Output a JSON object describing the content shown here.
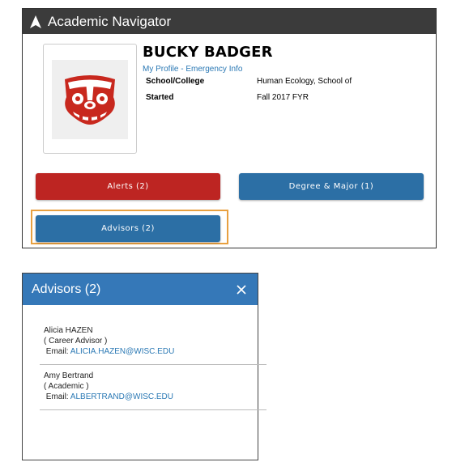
{
  "app": {
    "title": "Academic Navigator"
  },
  "profile": {
    "name": "BUCKY BADGER",
    "my_profile_link": "My Profile",
    "separator": " - ",
    "emergency_link": "Emergency Info",
    "fields": [
      {
        "label": "School/College",
        "value": "Human Ecology, School of"
      },
      {
        "label": "Started",
        "value": "Fall 2017 FYR"
      }
    ]
  },
  "buttons": {
    "alerts": "Alerts (2)",
    "degree_major": "Degree & Major (1)",
    "advisors": "Advisors (2)"
  },
  "modal": {
    "title": "Advisors (2)",
    "close_symbol": "×",
    "advisors": [
      {
        "name": "Alicia HAZEN",
        "role": "( Career Advisor )",
        "email_label": "Email: ",
        "email": "ALICIA.HAZEN@WISC.EDU"
      },
      {
        "name": "Amy Bertrand",
        "role": "( Academic )",
        "email_label": "Email: ",
        "email": "ALBERTRAND@WISC.EDU"
      }
    ]
  },
  "colors": {
    "header_dark": "#3b3b3b",
    "alert_red": "#bd2522",
    "primary_blue": "#2c6fa5",
    "modal_blue": "#3578b8",
    "highlight_orange": "#e8a040",
    "badger_red": "#c8281e"
  }
}
